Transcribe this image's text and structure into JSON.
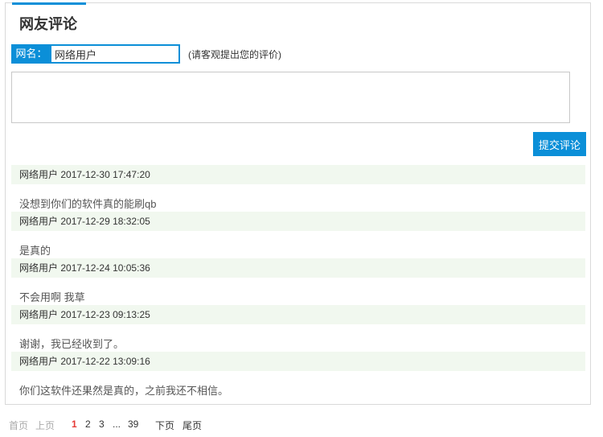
{
  "section": {
    "title": "网友评论"
  },
  "form": {
    "name_label": "网名：",
    "name_value": "网络用户",
    "hint": "(请客观提出您的评价)",
    "submit_label": "提交评论"
  },
  "comments": [
    {
      "user": "网络用户",
      "time": "2017-12-30 17:47:20",
      "text": "没想到你们的软件真的能刷qb"
    },
    {
      "user": "网络用户",
      "time": "2017-12-29 18:32:05",
      "text": "是真的"
    },
    {
      "user": "网络用户",
      "time": "2017-12-24 10:05:36",
      "text": "不会用啊 我草"
    },
    {
      "user": "网络用户",
      "time": "2017-12-23 09:13:25",
      "text": "谢谢，我已经收到了。"
    },
    {
      "user": "网络用户",
      "time": "2017-12-22 13:09:16",
      "text": "你们这软件还果然是真的，之前我还不相信。"
    }
  ],
  "pager": {
    "first": "首页",
    "prev": "上页",
    "pages": [
      "1",
      "2",
      "3"
    ],
    "ellipsis": "...",
    "last_page": "39",
    "next": "下页",
    "last": "尾页",
    "current": "1"
  },
  "colors": {
    "accent": "#0b8fd8",
    "meta_bg": "#f1f8ef",
    "current_page": "#e53935"
  }
}
